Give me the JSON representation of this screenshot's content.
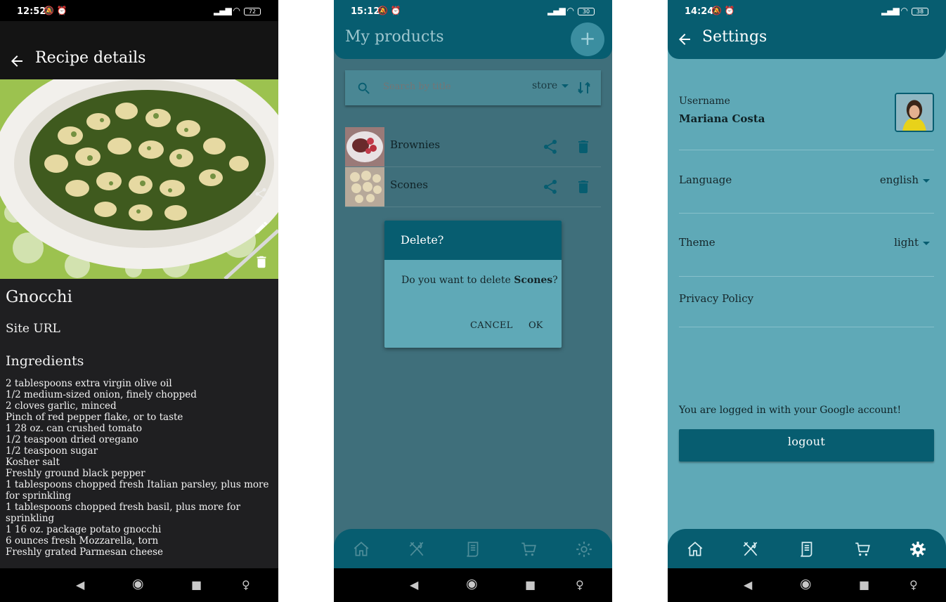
{
  "screen1": {
    "status": {
      "time": "12:52",
      "icons": "🔕 ⏰",
      "signal": "▂▄▆█ ◠",
      "battery": "72"
    },
    "title": "Recipe details",
    "recipe_name": "Gnocchi",
    "site_url_label": "Site URL",
    "ingredients_heading": "Ingredients",
    "ingredients": [
      "2 tablespoons extra virgin olive oil",
      "1/2 medium-sized onion, finely chopped",
      "2 cloves garlic, minced",
      "Pinch of red pepper flake, or to taste",
      "1 28 oz. can crushed tomato",
      "1/2 teaspoon dried oregano",
      "1/2 teaspoon sugar",
      "Kosher salt",
      "Freshly ground black pepper",
      "1 tablespoons chopped fresh Italian parsley, plus more for sprinkling",
      "1 tablespoons chopped fresh basil, plus more for sprinkling",
      "1 16 oz. package potato gnocchi",
      "6 ounces fresh Mozzarella, torn",
      "Freshly grated Parmesan cheese"
    ],
    "icons": [
      "back-arrow-icon",
      "share-icon",
      "edit-pencil-icon",
      "trash-icon"
    ]
  },
  "screen2": {
    "status": {
      "time": "15:12",
      "icons": "🔕 ⏰",
      "battery": "30"
    },
    "title": "My products",
    "search_placeholder": "Search by title",
    "sort_field": "store",
    "products": [
      {
        "name": "Brownies"
      },
      {
        "name": "Scones"
      }
    ],
    "dialog": {
      "title": "Delete?",
      "message_prefix": "Do you want to delete ",
      "message_item": "Scones",
      "message_suffix": "?",
      "cancel": "CANCEL",
      "ok": "OK"
    }
  },
  "screen3": {
    "status": {
      "time": "14:24",
      "icons": "🔕 ⏰",
      "battery": "38"
    },
    "title": "Settings",
    "username_label": "Username",
    "username": "Mariana Costa",
    "language_label": "Language",
    "language_value": "english",
    "theme_label": "Theme",
    "theme_value": "light",
    "privacy_label": "Privacy Policy",
    "logged_in_text": "You are logged in with your Google account!",
    "logout_label": "logout"
  },
  "colors": {
    "primary": "#075d70",
    "surface": "#5fa9b7",
    "dark": "#1f1f21"
  }
}
